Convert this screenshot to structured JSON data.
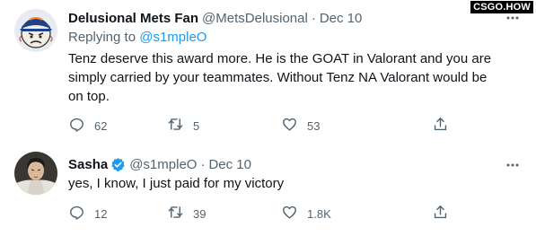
{
  "watermark": "CSGO.HOW",
  "tweets": [
    {
      "name": "Delusional Mets Fan",
      "handle": "@MetsDelusional",
      "separator": "·",
      "date": "Dec 10",
      "replying_label": "Replying to",
      "replying_to": "@s1mpleO",
      "text": "Tenz deserve this award more. He is the GOAT in Valorant and you are simply carried by your teammates. Without Tenz NA Valorant would be on top.",
      "reply_count": "62",
      "retweet_count": "5",
      "like_count": "53",
      "verified": false
    },
    {
      "name": "Sasha",
      "handle": "@s1mpleO",
      "separator": "·",
      "date": "Dec 10",
      "text": "yes, I know, I just paid for my victory",
      "reply_count": "12",
      "retweet_count": "39",
      "like_count": "1.8K",
      "verified": true
    }
  ],
  "icons": [
    "reply-icon",
    "retweet-icon",
    "like-icon",
    "share-icon",
    "more-icon",
    "verified-icon"
  ],
  "colors": {
    "text": "#0f1419",
    "secondary": "#536471",
    "accent": "#1d9bf0"
  }
}
